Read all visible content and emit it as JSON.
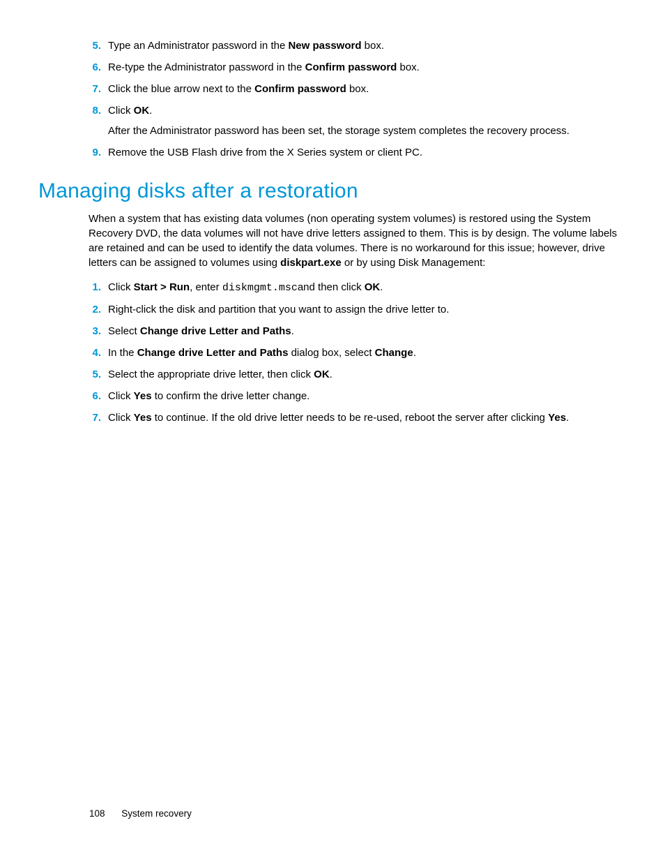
{
  "list1": {
    "items": [
      {
        "num": "5.",
        "pre": "Type an Administrator password in the ",
        "b1": "New password",
        "post": " box."
      },
      {
        "num": "6.",
        "pre": "Re-type the Administrator password in the ",
        "b1": "Confirm password",
        "post": " box."
      },
      {
        "num": "7.",
        "pre": "Click the blue arrow next to the ",
        "b1": "Confirm password",
        "post": " box."
      },
      {
        "num": "8.",
        "pre": "Click ",
        "b1": "OK",
        "post": ".",
        "sub": "After the Administrator password has been set, the storage system completes the recovery process."
      },
      {
        "num": "9.",
        "pre": "Remove the USB Flash drive from the X Series system or client PC.",
        "b1": "",
        "post": ""
      }
    ]
  },
  "heading": "Managing disks after a restoration",
  "intro": {
    "pre": "When a system that has existing data volumes (non operating system volumes) is restored using the System Recovery DVD, the data volumes will not have drive letters assigned to them. This is by design. The volume labels are retained and can be used to identify the data volumes. There is no workaround for this issue; however, drive letters can be assigned to volumes using ",
    "b": "diskpart.exe",
    "post": " or by using Disk Management:"
  },
  "list2": {
    "items": [
      {
        "num": "1.",
        "segments": [
          {
            "t": "Click "
          },
          {
            "b": "Start > Run"
          },
          {
            "t": ", enter "
          },
          {
            "m": "diskmgmt.msc"
          },
          {
            "t": "and then click "
          },
          {
            "b": "OK"
          },
          {
            "t": "."
          }
        ]
      },
      {
        "num": "2.",
        "segments": [
          {
            "t": "Right-click the disk and partition that you want to assign the drive letter to."
          }
        ]
      },
      {
        "num": "3.",
        "segments": [
          {
            "t": "Select "
          },
          {
            "b": "Change drive Letter and Paths"
          },
          {
            "t": "."
          }
        ]
      },
      {
        "num": "4.",
        "segments": [
          {
            "t": "In the "
          },
          {
            "b": "Change drive Letter and Paths"
          },
          {
            "t": " dialog box, select "
          },
          {
            "b": "Change"
          },
          {
            "t": "."
          }
        ]
      },
      {
        "num": "5.",
        "segments": [
          {
            "t": "Select the appropriate drive letter, then click "
          },
          {
            "b": "OK"
          },
          {
            "t": "."
          }
        ]
      },
      {
        "num": "6.",
        "segments": [
          {
            "t": "Click "
          },
          {
            "b": "Yes"
          },
          {
            "t": " to confirm the drive letter change."
          }
        ]
      },
      {
        "num": "7.",
        "segments": [
          {
            "t": "Click "
          },
          {
            "b": "Yes"
          },
          {
            "t": " to continue. If the old drive letter needs to be re-used, reboot the server after clicking "
          },
          {
            "b": "Yes"
          },
          {
            "t": "."
          }
        ]
      }
    ]
  },
  "footer": {
    "page": "108",
    "title": "System recovery"
  }
}
